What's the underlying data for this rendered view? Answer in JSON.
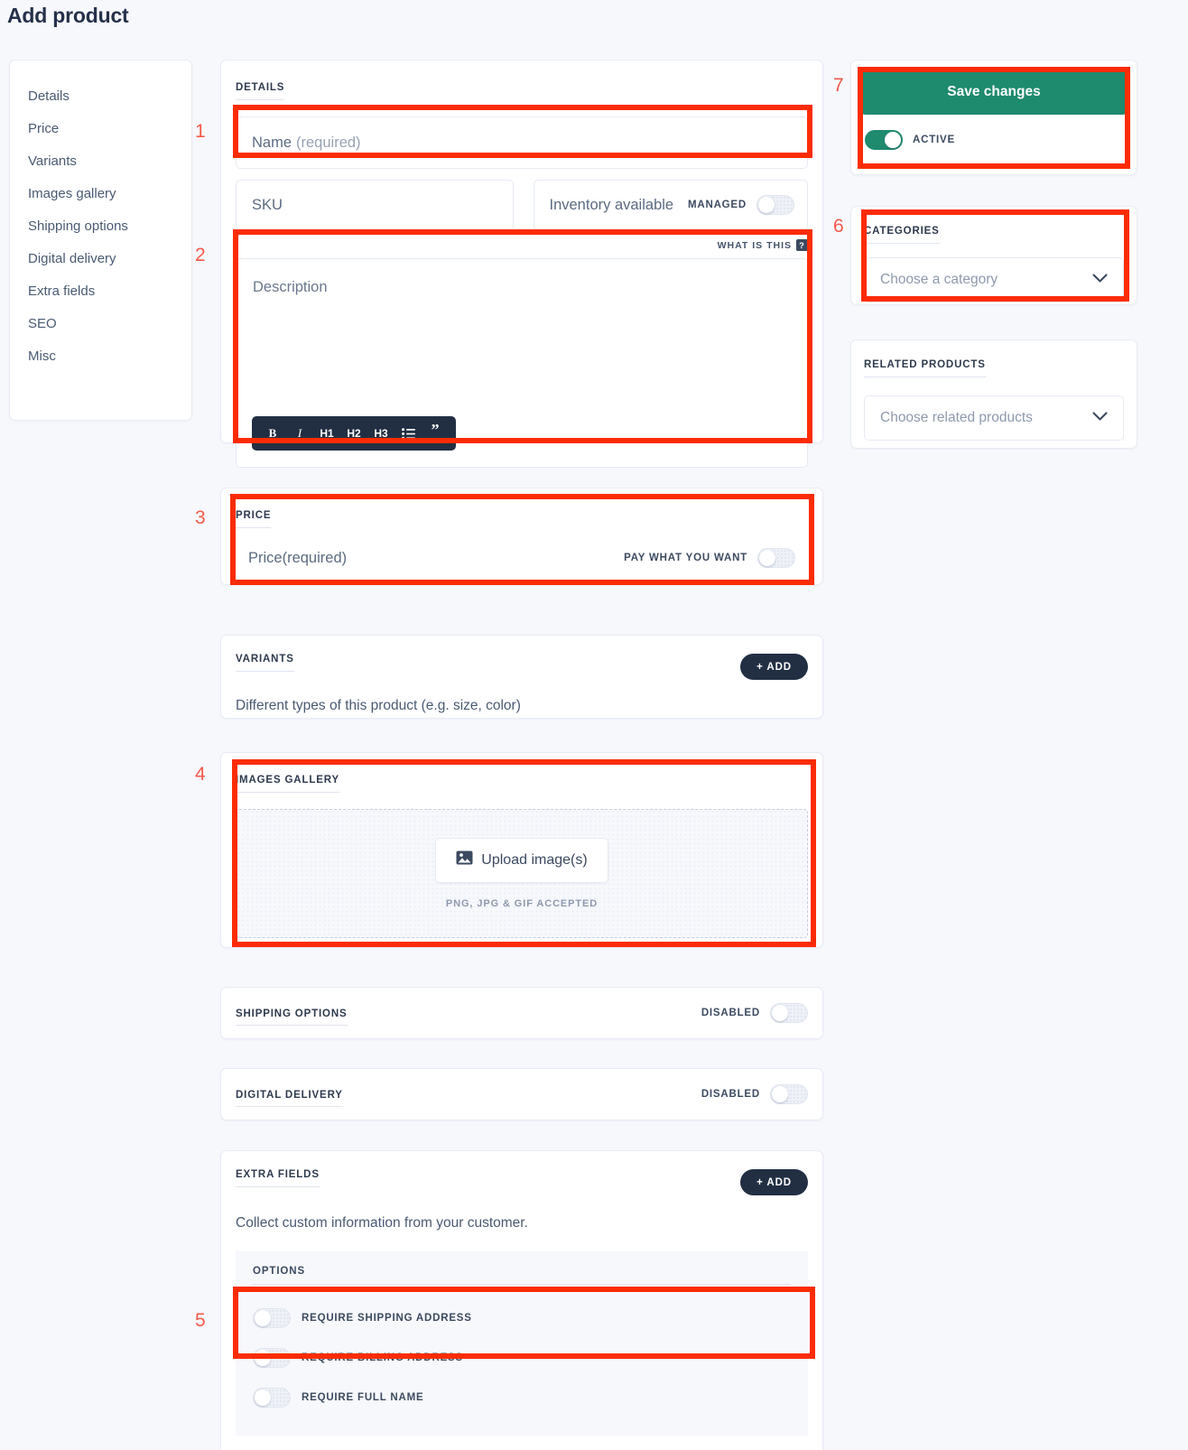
{
  "page": {
    "title": "Add product"
  },
  "colors": {
    "accent_green": "#1e8a6e",
    "dark": "#222f43",
    "annotation_red": "#fb2c05",
    "page_bg": "#f7f8fc"
  },
  "sidebar": {
    "items": [
      {
        "label": "Details"
      },
      {
        "label": "Price"
      },
      {
        "label": "Variants"
      },
      {
        "label": "Images gallery"
      },
      {
        "label": "Shipping options"
      },
      {
        "label": "Digital delivery"
      },
      {
        "label": "Extra fields"
      },
      {
        "label": "SEO"
      },
      {
        "label": "Misc"
      }
    ]
  },
  "annotations": [
    {
      "number": "1"
    },
    {
      "number": "2"
    },
    {
      "number": "3"
    },
    {
      "number": "4"
    },
    {
      "number": "5"
    },
    {
      "number": "6"
    },
    {
      "number": "7"
    }
  ],
  "details": {
    "heading": "DETAILS",
    "name_label": "Name",
    "name_required": "(required)",
    "name_value": "",
    "sku_placeholder": "SKU",
    "sku_value": "",
    "inventory_placeholder": "Inventory available",
    "inventory_value": "",
    "managed_label": "MANAGED",
    "managed_on": false,
    "what_is_this": "WHAT IS THIS",
    "help_badge": "?"
  },
  "description": {
    "placeholder": "Description",
    "value": "",
    "toolbar": [
      {
        "name": "bold-icon",
        "glyph": "B"
      },
      {
        "name": "italic-icon",
        "glyph": "I"
      },
      {
        "name": "heading-1-icon",
        "glyph": "H1"
      },
      {
        "name": "heading-2-icon",
        "glyph": "H2"
      },
      {
        "name": "heading-3-icon",
        "glyph": "H3"
      },
      {
        "name": "bullet-list-icon",
        "glyph": "☰"
      },
      {
        "name": "blockquote-icon",
        "glyph": "”"
      }
    ]
  },
  "price": {
    "heading": "PRICE",
    "label": "Price",
    "required": "(required)",
    "value": "",
    "pay_what_you_want_label": "PAY WHAT YOU WANT",
    "pay_what_you_want_on": false
  },
  "variants": {
    "heading": "VARIANTS",
    "add_label": "+ ADD",
    "description": "Different types of this product (e.g. size, color)"
  },
  "images_gallery": {
    "heading": "IMAGES GALLERY",
    "upload_label": "Upload image(s)",
    "upload_icon": "image-upload-icon",
    "accepted_note": "PNG, JPG & GIF ACCEPTED"
  },
  "shipping_options": {
    "heading": "SHIPPING OPTIONS",
    "state_label": "DISABLED",
    "enabled": false
  },
  "digital_delivery": {
    "heading": "DIGITAL DELIVERY",
    "state_label": "DISABLED",
    "enabled": false
  },
  "extra_fields": {
    "heading": "EXTRA FIELDS",
    "add_label": "+ ADD",
    "description": "Collect custom information from your customer.",
    "options_heading": "OPTIONS",
    "options": [
      {
        "label": "REQUIRE SHIPPING ADDRESS",
        "on": false
      },
      {
        "label": "REQUIRE BILLING ADDRESS",
        "on": false
      },
      {
        "label": "REQUIRE FULL NAME",
        "on": false
      }
    ]
  },
  "save_panel": {
    "save_label": "Save changes",
    "active_label": "ACTIVE",
    "active_on": true
  },
  "categories": {
    "heading": "CATEGORIES",
    "placeholder": "Choose a category"
  },
  "related_products": {
    "heading": "RELATED PRODUCTS",
    "placeholder": "Choose related products"
  }
}
